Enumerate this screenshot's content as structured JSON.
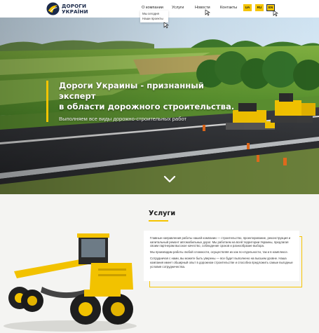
{
  "logo": {
    "line1": "ДОРОГИ",
    "line2": "УКРАЇНИ",
    "icon": "road-logo-icon"
  },
  "nav": {
    "items": [
      {
        "label": "О компании",
        "active": true
      },
      {
        "label": "Услуги",
        "active": false
      },
      {
        "label": "Новости",
        "active": false
      },
      {
        "label": "Контакты",
        "active": false
      }
    ],
    "dropdown": [
      "Мы сегодня",
      "Наши проекты"
    ]
  },
  "languages": [
    "UA",
    "RU",
    "EN"
  ],
  "hero": {
    "title_line1": "Дороги Украины - признанный эксперт",
    "title_line2": "в области дорожного строительства.",
    "subtitle": "Выполняем все виды дорожно-строительных работ",
    "scroll_icon": "chevron-down-icon"
  },
  "services": {
    "title": "Услуги",
    "paragraphs": [
      "Главные направления работы нашей компании — строительство, проектирование, реконструкция и капитальный ремонт автомобильных дорог. Мы работаем на всей территории Украины, предлагая своим партнерам высокое качество, соблюдение сроков и разнообразие выбора.",
      "Мы производим работы любой сложности, осуществляя их как по-отдельности, так и в комплексе.",
      "Сотрудничая с нами, вы можете быть уверены — все будет выполнено на высшем уровне. Наша компания имеет обширный опыт в дорожном строительстве и способна предложить самые выгодные условия сотрудничества."
    ]
  },
  "colors": {
    "accent": "#f5c400",
    "brand_dark": "#1b2a4a",
    "section_bg": "#f4f4f2"
  }
}
